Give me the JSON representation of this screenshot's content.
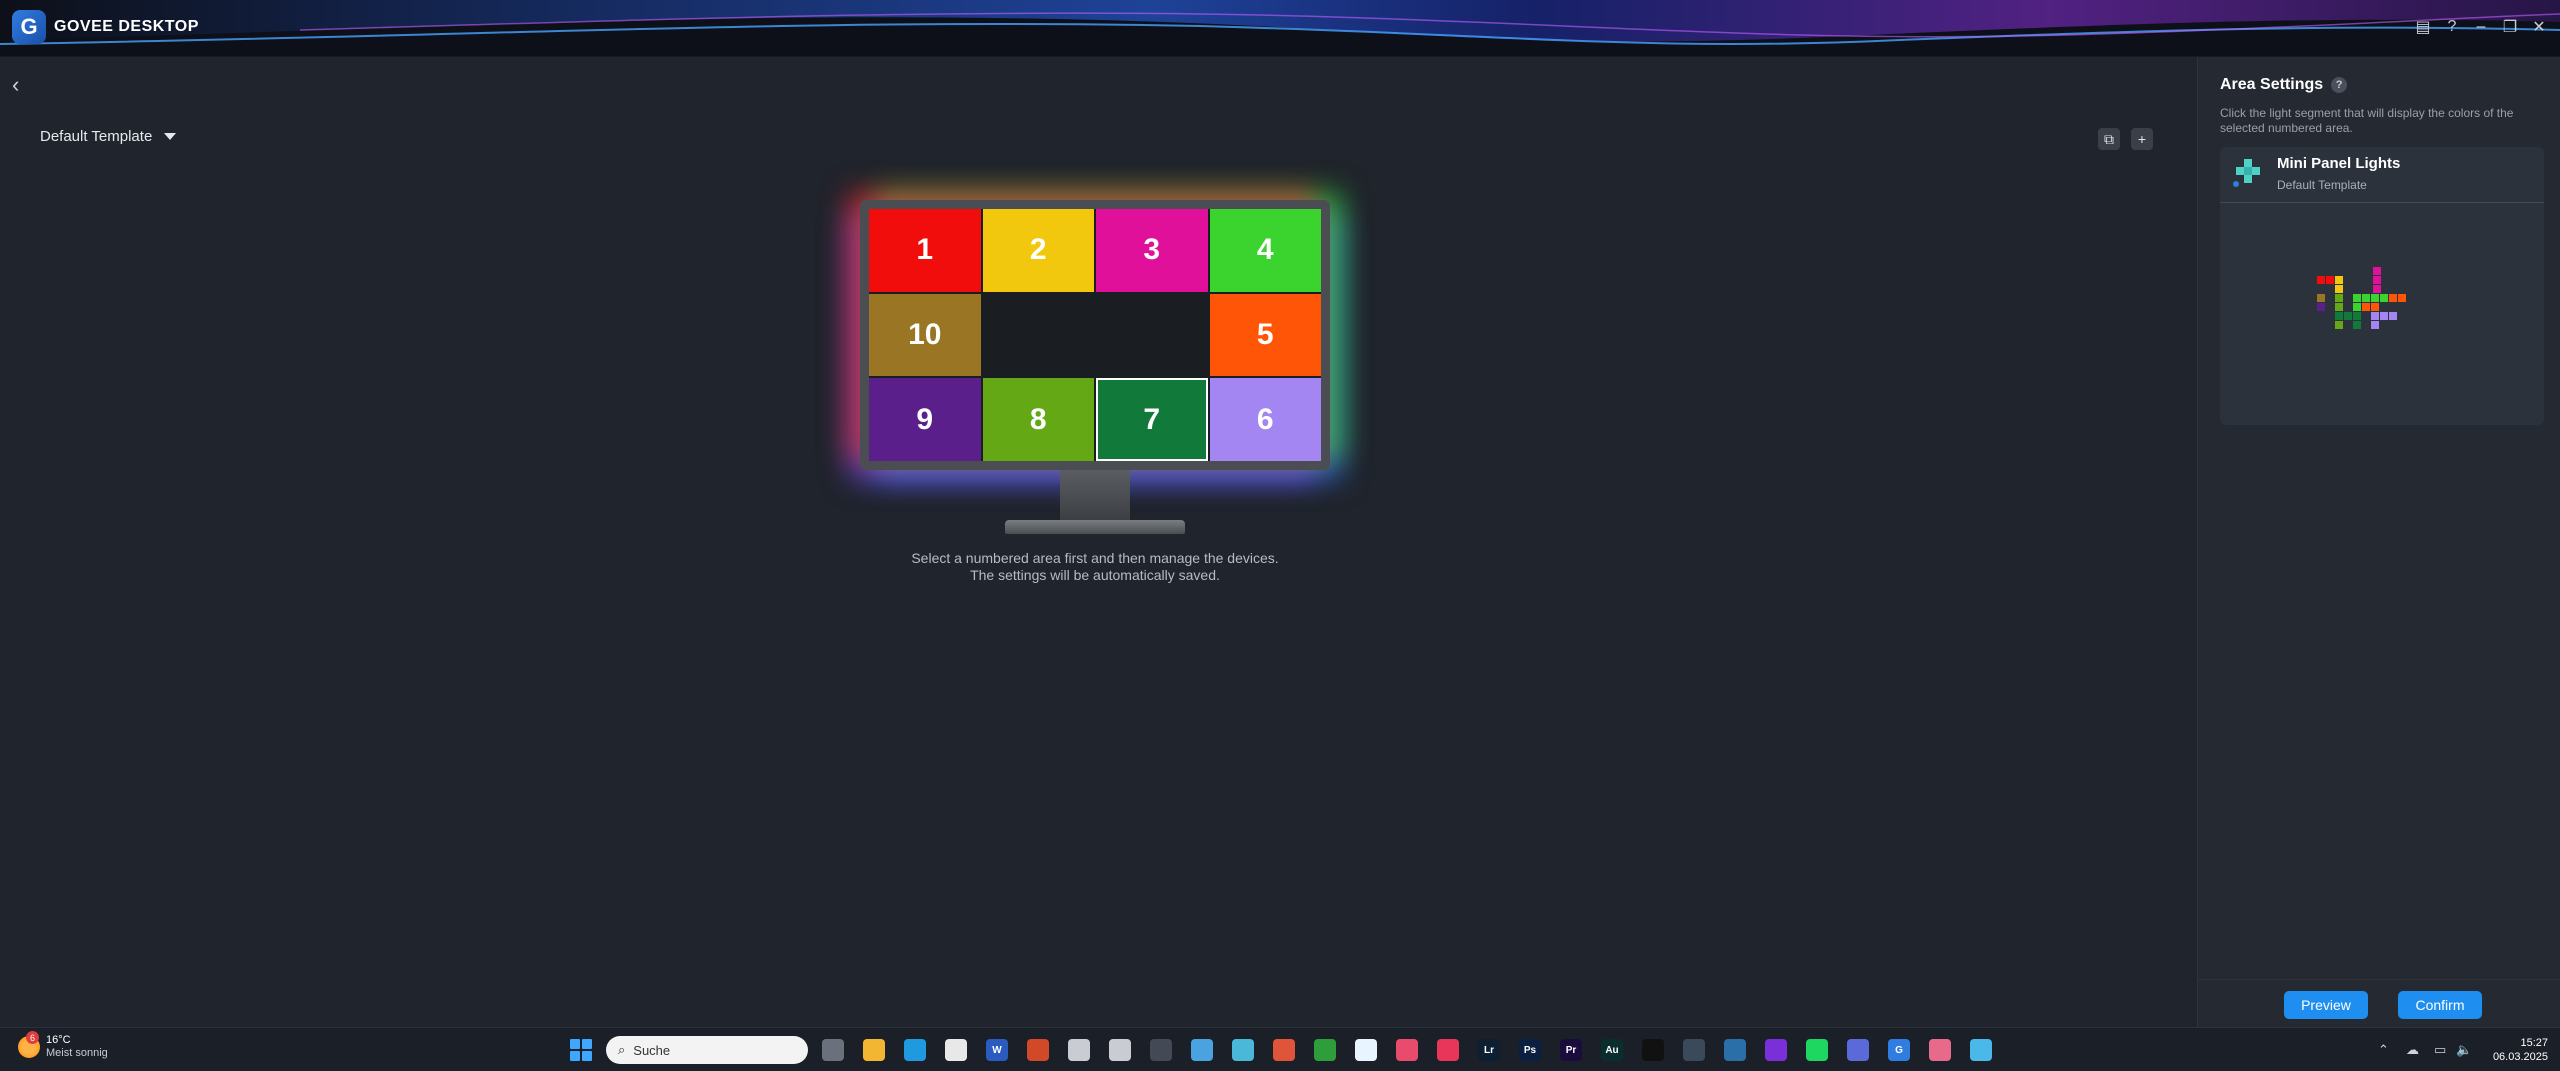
{
  "app": {
    "title": "GOVEE DESKTOP",
    "logo_letter": "G"
  },
  "window_controls": [
    {
      "name": "log-icon",
      "glyph": "▤"
    },
    {
      "name": "help-icon",
      "glyph": "?"
    },
    {
      "name": "minimize-icon",
      "glyph": "–"
    },
    {
      "name": "restore-icon",
      "glyph": "❐"
    },
    {
      "name": "close-icon",
      "glyph": "✕"
    }
  ],
  "main": {
    "back_glyph": "‹",
    "template_label": "Default Template",
    "copy_glyph": "⧉",
    "add_glyph": "+",
    "hint_line1": "Select a numbered area first and then manage the devices.",
    "hint_line2": "The settings will be automatically saved."
  },
  "areas": [
    {
      "label": "1",
      "color": "#f20d0d"
    },
    {
      "label": "2",
      "color": "#f2c80f"
    },
    {
      "label": "3",
      "color": "#e0109a"
    },
    {
      "label": "4",
      "color": "#3bd42f"
    },
    {
      "label": "10",
      "color": "#9a7624"
    },
    {
      "label": "",
      "color": "#1a1d22"
    },
    {
      "label": "",
      "color": "#1a1d22"
    },
    {
      "label": "5",
      "color": "#ff5506"
    },
    {
      "label": "9",
      "color": "#5a1f8a"
    },
    {
      "label": "8",
      "color": "#64a816"
    },
    {
      "label": "7",
      "color": "#117a3a",
      "selected": true
    },
    {
      "label": "6",
      "color": "#a486f2"
    }
  ],
  "panel": {
    "title": "Area Settings",
    "help": "?",
    "description": "Click the light segment that will display the colors of the selected numbered area.",
    "device_name": "Mini Panel Lights",
    "device_template": "Default Template",
    "preview_label": "Preview",
    "confirm_label": "Confirm"
  },
  "taskbar": {
    "weather_badge": "6",
    "temperature": "16°C",
    "weather_desc": "Meist sonnig",
    "search_placeholder": "Suche",
    "apps": [
      {
        "name": "task-view-icon",
        "text": "",
        "color": "#6b717c"
      },
      {
        "name": "file-explorer-icon",
        "text": "",
        "color": "#f2b632"
      },
      {
        "name": "edge-icon",
        "text": "",
        "color": "#1f9ae0"
      },
      {
        "name": "store-icon",
        "text": "",
        "color": "#e8e8e8"
      },
      {
        "name": "word-icon",
        "text": "W",
        "color": "#2b5bbf"
      },
      {
        "name": "powerpoint-icon",
        "text": "",
        "color": "#d2492a"
      },
      {
        "name": "app-ring-icon",
        "text": "",
        "color": "#c9ccd3"
      },
      {
        "name": "app-dial-icon",
        "text": "",
        "color": "#c9ccd3"
      },
      {
        "name": "terminal-icon",
        "text": "",
        "color": "#444a55"
      },
      {
        "name": "screen-app-icon",
        "text": "",
        "color": "#4aa3e0"
      },
      {
        "name": "window-app-icon",
        "text": "",
        "color": "#4ab8d8"
      },
      {
        "name": "creative-app-icon",
        "text": "",
        "color": "#e0553a"
      },
      {
        "name": "xbox-icon",
        "text": "",
        "color": "#2e9e3a"
      },
      {
        "name": "cloud-app-icon",
        "text": "",
        "color": "#e8f4ff"
      },
      {
        "name": "color-app-icon",
        "text": "",
        "color": "#e84b6b"
      },
      {
        "name": "music-app-icon",
        "text": "",
        "color": "#e8355a"
      },
      {
        "name": "lightroom-icon",
        "text": "Lr",
        "color": "#0c1f33"
      },
      {
        "name": "photoshop-icon",
        "text": "Ps",
        "color": "#0b2040"
      },
      {
        "name": "premiere-icon",
        "text": "Pr",
        "color": "#1a0d3d"
      },
      {
        "name": "audition-icon",
        "text": "Au",
        "color": "#0a2e2e"
      },
      {
        "name": "dark-app-icon",
        "text": "",
        "color": "#111111"
      },
      {
        "name": "photo-app-icon",
        "text": "",
        "color": "#3a4a5a"
      },
      {
        "name": "steam-icon",
        "text": "",
        "color": "#2a6fa8"
      },
      {
        "name": "circle-app-icon",
        "text": "",
        "color": "#7b2fd8"
      },
      {
        "name": "spotify-icon",
        "text": "",
        "color": "#1ed760"
      },
      {
        "name": "globe-app-icon",
        "text": "",
        "color": "#5a6ad8"
      },
      {
        "name": "govee-taskbar-icon",
        "text": "G",
        "color": "#2f7de1"
      },
      {
        "name": "gallery-app-icon",
        "text": "",
        "color": "#e86a8a"
      },
      {
        "name": "notepad-icon",
        "text": "",
        "color": "#4ab8e8"
      }
    ],
    "time": "15:27",
    "date": "06.03.2025"
  }
}
